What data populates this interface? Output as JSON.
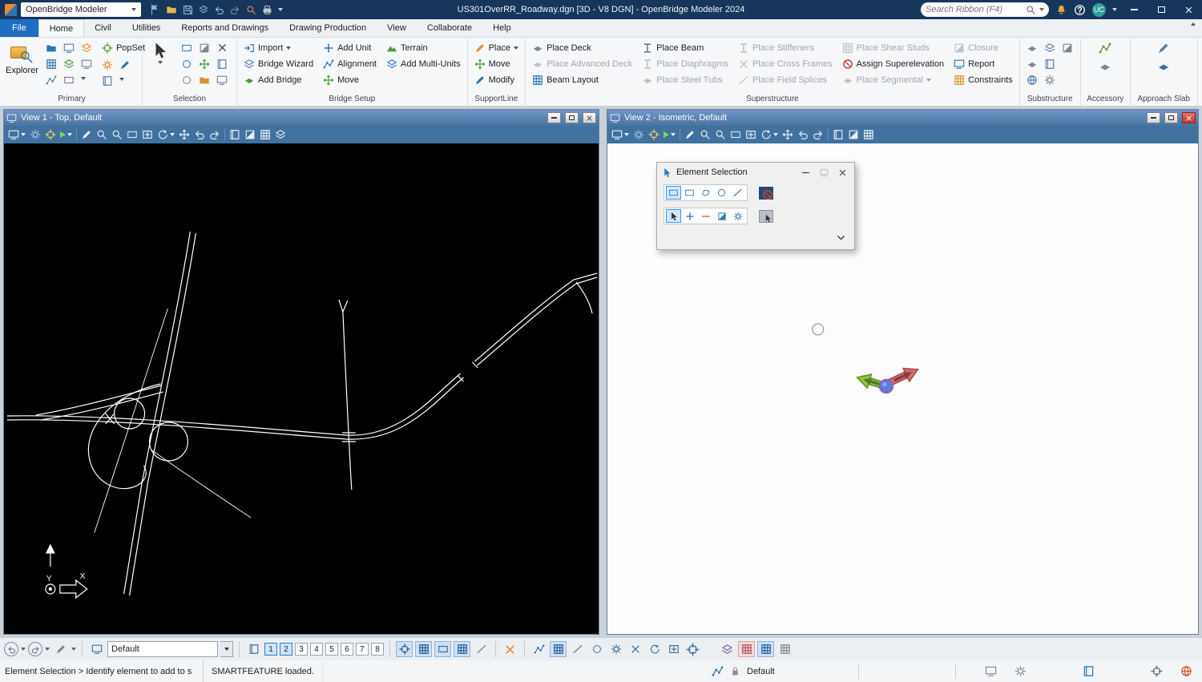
{
  "titlebar": {
    "app_menu": "OpenBridge Modeler",
    "document_title": "US301OverRR_Roadway.dgn [3D - V8 DGN] - OpenBridge Modeler 2024",
    "search_placeholder": "Search Ribbon (F4)",
    "user_initials": "UC"
  },
  "tabs": {
    "items": [
      "File",
      "Home",
      "Civil",
      "Utilities",
      "Reports and Drawings",
      "Drawing Production",
      "View",
      "Collaborate",
      "Help"
    ],
    "active": "Home"
  },
  "ribbon": {
    "primary": {
      "label": "Primary",
      "explorer": "Explorer",
      "popset": "PopSet"
    },
    "selection": {
      "label": "Selection"
    },
    "bridge_setup": {
      "label": "Bridge Setup",
      "import": "Import",
      "add_unit": "Add Unit",
      "terrain": "Terrain",
      "bridge_wizard": "Bridge Wizard",
      "alignment": "Alignment",
      "add_multi_units": "Add Multi-Units",
      "add_bridge": "Add Bridge",
      "move": "Move"
    },
    "supportline": {
      "label": "SupportLine",
      "place": "Place",
      "move": "Move",
      "modify": "Modify"
    },
    "superstructure": {
      "label": "Superstructure",
      "place_deck": "Place Deck",
      "place_advanced_deck": "Place Advanced Deck",
      "beam_layout": "Beam Layout",
      "place_beam": "Place Beam",
      "place_diaphragms": "Place Diaphragms",
      "place_steel_tubs": "Place Steel Tubs",
      "place_stiffeners": "Place Stiffeners",
      "place_cross_frames": "Place Cross Frames",
      "place_field_splices": "Place Field Splices",
      "place_shear_studs": "Place Shear Studs",
      "assign_superelevation": "Assign Superelevation",
      "place_segmental": "Place Segmental",
      "closure": "Closure",
      "report": "Report",
      "constraints": "Constraints"
    },
    "substructure": {
      "label": "Substructure"
    },
    "accessory": {
      "label": "Accessory"
    },
    "approach_slab": {
      "label": "Approach Slab"
    }
  },
  "views": {
    "view1_title": "View 1 - Top, Default",
    "view2_title": "View 2 - Isometric, Default",
    "axis_y": "Y",
    "axis_x": "X"
  },
  "dialog": {
    "title": "Element Selection"
  },
  "bottom_toolbar": {
    "view_group": "Default",
    "numbers": [
      "1",
      "2",
      "3",
      "4",
      "5",
      "6",
      "7",
      "8"
    ],
    "active_numbers": [
      "1",
      "2"
    ]
  },
  "statusbar": {
    "prompt": "Element Selection > Identify element to add to s",
    "message": "SMARTFEATURE loaded.",
    "model": "Default"
  }
}
